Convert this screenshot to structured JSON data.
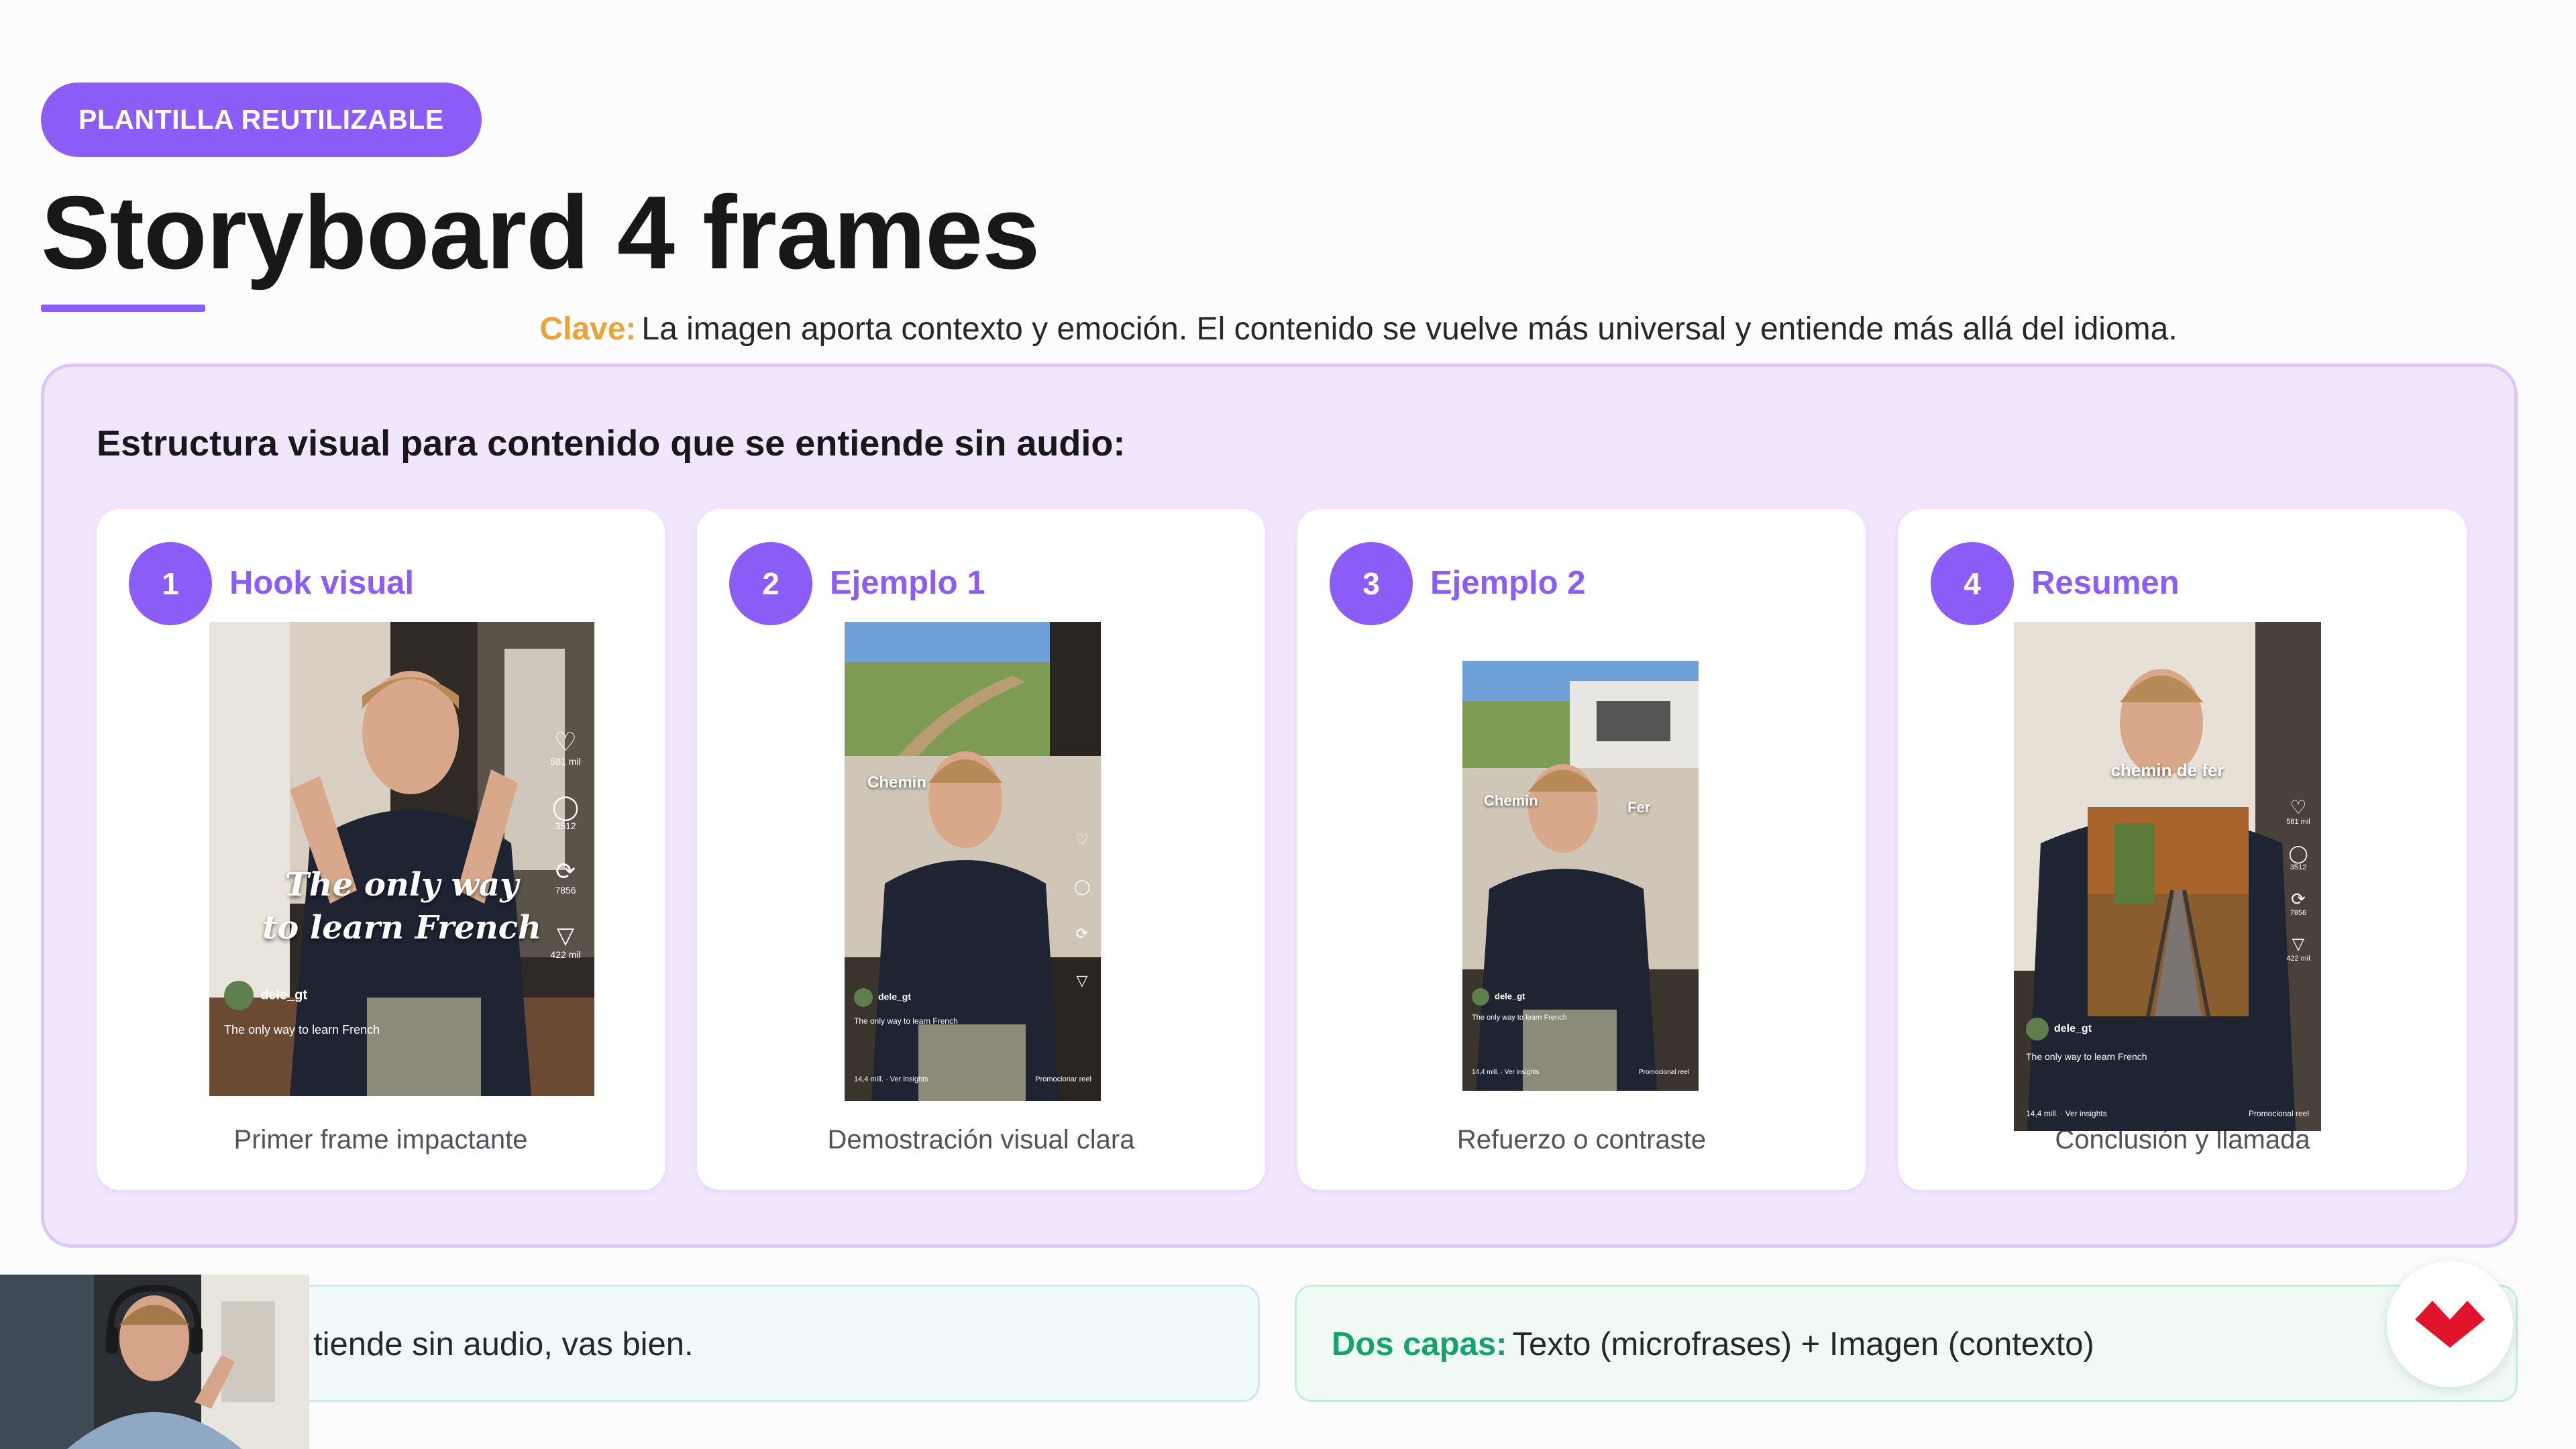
{
  "badge": "PLANTILLA REUTILIZABLE",
  "title": "Storyboard 4 frames",
  "key": {
    "label": "Clave:",
    "text": "La imagen aporta contexto y emoción. El contenido se vuelve más universal y entiende más allá del idioma."
  },
  "panel": {
    "heading": "Estructura visual para contenido que se entiende sin audio:",
    "cards": [
      {
        "number": "1",
        "title": "Hook visual",
        "caption": "Primer frame impactante",
        "overlay_lines": [
          "The only way",
          "to learn French"
        ],
        "handle": "dele_gt",
        "post_text": "The only way to learn French",
        "likes": "581 mil",
        "comments": "3512",
        "shares": "7856",
        "saves": "422 mil"
      },
      {
        "number": "2",
        "title": "Ejemplo 1",
        "caption": "Demostración visual clara",
        "overlay_lines": [
          "Chemin"
        ],
        "handle": "dele_gt",
        "post_text": "The only way to learn French",
        "footer_left": "14,4 mill. · Ver insights",
        "footer_right": "Promocionar reel"
      },
      {
        "number": "3",
        "title": "Ejemplo 2",
        "caption": "Refuerzo o contraste",
        "overlay_lines": [
          "Chemin",
          "Fer"
        ],
        "handle": "dele_gt",
        "post_text": "The only way to learn French",
        "footer_left": "14,4 mill. · Ver insights",
        "footer_right": "Promocional reel"
      },
      {
        "number": "4",
        "title": "Resumen",
        "caption": "Conclusión y llamada",
        "overlay_lines": [
          "chemin de fer"
        ],
        "handle": "dele_gt",
        "post_text": "The only way to learn French",
        "likes": "581 mil",
        "comments": "3512",
        "shares": "7856",
        "saves": "422 mil",
        "footer_left": "14,4 mill. · Ver insights",
        "footer_right": "Promocional reel"
      }
    ]
  },
  "bottom": {
    "left_text": "tiende sin audio, vas bien.",
    "right_label": "Dos capas:",
    "right_text": "Texto (microfrases) + Imagen (contexto)"
  },
  "colors": {
    "accent": "#8b5cf6",
    "key": "#e7a43a",
    "green": "#16a36b",
    "logo": "#e0152b"
  },
  "icons": [
    "heart-icon",
    "comment-icon",
    "repost-icon",
    "send-icon",
    "more-icon",
    "logo-icon"
  ]
}
